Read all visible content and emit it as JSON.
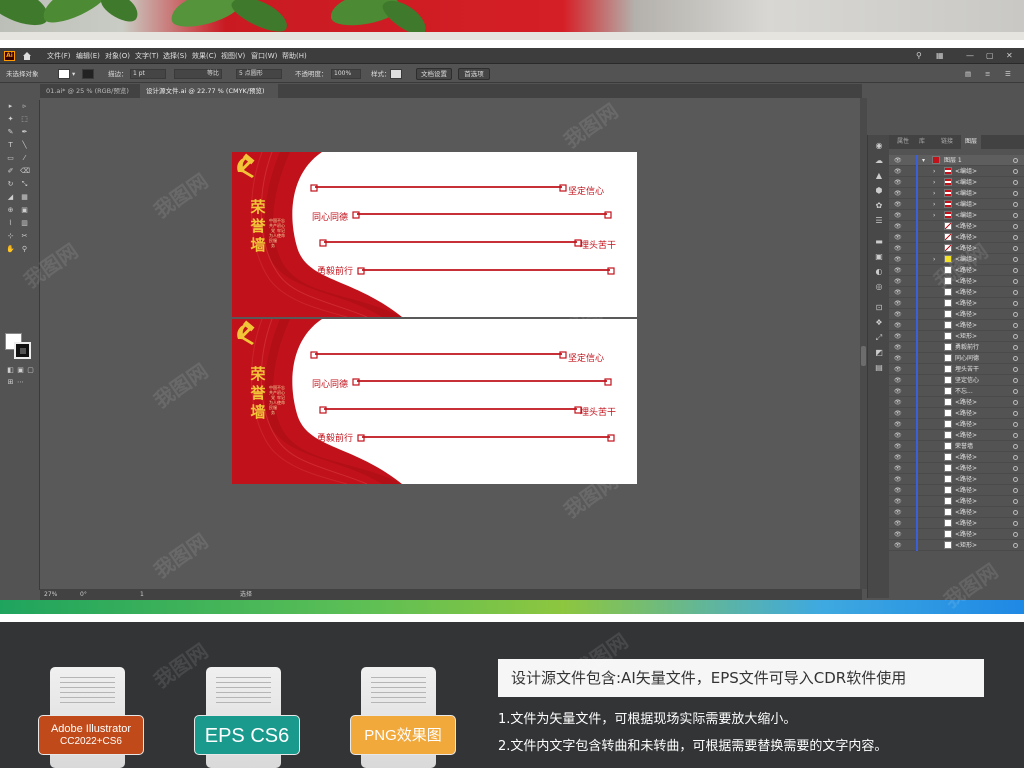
{
  "app": {
    "logo": "Ai",
    "menu": [
      "文件(F)",
      "编辑(E)",
      "对象(O)",
      "文字(T)",
      "选择(S)",
      "效果(C)",
      "视图(V)",
      "窗口(W)",
      "帮助(H)"
    ]
  },
  "control_bar": {
    "selection_label": "未选择对象",
    "stroke_label": "描边：",
    "stroke_value": "1 pt",
    "stroke_style": "等比",
    "brush": "5 点圆形",
    "opacity_label": "不透明度：",
    "opacity_value": "100%",
    "style_label": "样式：",
    "doc_setup_button": "文档设置",
    "prefs_button": "首选项"
  },
  "tabs": [
    {
      "label": "01.ai* @ 25 % (RGB/预览)",
      "close": "×"
    },
    {
      "label": "设计源文件.ai @ 22.77 % (CMYK/预览)",
      "close": "×"
    }
  ],
  "status_bar": {
    "zoom": "27%",
    "rotation": "0°",
    "page": "1",
    "tool": "选择"
  },
  "artboards": [
    {
      "title": "荣誉墙",
      "subtitle_1": "不忘初心 牢记使命",
      "subtitle_2": "中国共产党 为人民服务",
      "slogans": [
        "坚定信心",
        "同心同德",
        "埋头苦干",
        "勇毅前行"
      ]
    },
    {
      "title": "荣誉墙",
      "subtitle_1": "不忘初心 牢记使命",
      "subtitle_2": "中国共产党 为人民服务",
      "slogans": [
        "坚定信心",
        "同心同德",
        "埋头苦干",
        "勇毅前行"
      ]
    }
  ],
  "layers_panel": {
    "tabs": [
      "属性",
      "库",
      "链接",
      "图层"
    ],
    "rows": [
      "图层 1",
      "<编组>",
      "<编组>",
      "<编组>",
      "<编组>",
      "<编组>",
      "<路径>",
      "<路径>",
      "<路径>",
      "<编组>",
      "<路径>",
      "<路径>",
      "<路径>",
      "<路径>",
      "<路径>",
      "<路径>",
      "<矩形>",
      "勇毅前行",
      "同心同德",
      "埋头苦干",
      "坚定信心",
      "不忘...",
      "<路径>",
      "<路径>",
      "<路径>",
      "<路径>",
      "荣誉墙",
      "<路径>",
      "<路径>",
      "<路径>",
      "<路径>",
      "<路径>",
      "<路径>",
      "<路径>",
      "<路径>",
      "<矩形>"
    ]
  },
  "downloads": [
    {
      "name": "Adobe Illustrator",
      "version": "CC2022+CS6",
      "color": "#c14a1a"
    },
    {
      "name": "EPS CS6",
      "version": "",
      "color": "#1a9a8d"
    },
    {
      "name": "PNG效果图",
      "version": "",
      "color": "#f2a93b"
    }
  ],
  "description": {
    "heading": "设计源文件包含:AI矢量文件，EPS文件可导入CDR软件使用",
    "items": [
      "1.文件为矢量文件，可根据现场实际需要放大缩小。",
      "2.文件内文字包含转曲和未转曲，可根据需要替换需要的文字内容。"
    ]
  },
  "colors": {
    "party_red": "#c1121b",
    "gold": "#f2c437",
    "ui_dark": "#535353"
  },
  "watermark": "我图网"
}
